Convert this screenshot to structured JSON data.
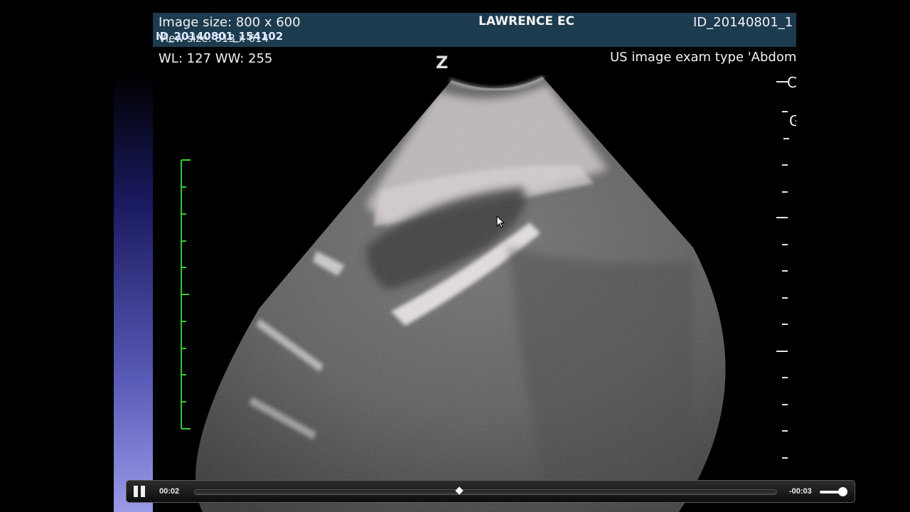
{
  "header": {
    "image_size": "Image size: 800 x 600",
    "view_size": "View size: 813 x 614",
    "study_id_left": "ID_20140801_154102",
    "patient_name": "LAWRENCE EC",
    "study_id_right": "ID_20140801_1",
    "window_level": "WL: 127 WW: 255",
    "exam_type": "US image exam type 'Abdomir",
    "orientation_marker": "Z",
    "right_markers": [
      "C",
      "G"
    ]
  },
  "player": {
    "elapsed": "00:02",
    "remaining": "-00:03",
    "progress": 0.4,
    "volume": 0.85
  },
  "colors": {
    "top_bar": "#1d3b4f",
    "depth_scale": "#33cc33",
    "side_gradient_bottom": "#9a9ae8"
  },
  "icons": {
    "pause": "pause-icon",
    "cursor": "mouse-pointer-icon"
  }
}
